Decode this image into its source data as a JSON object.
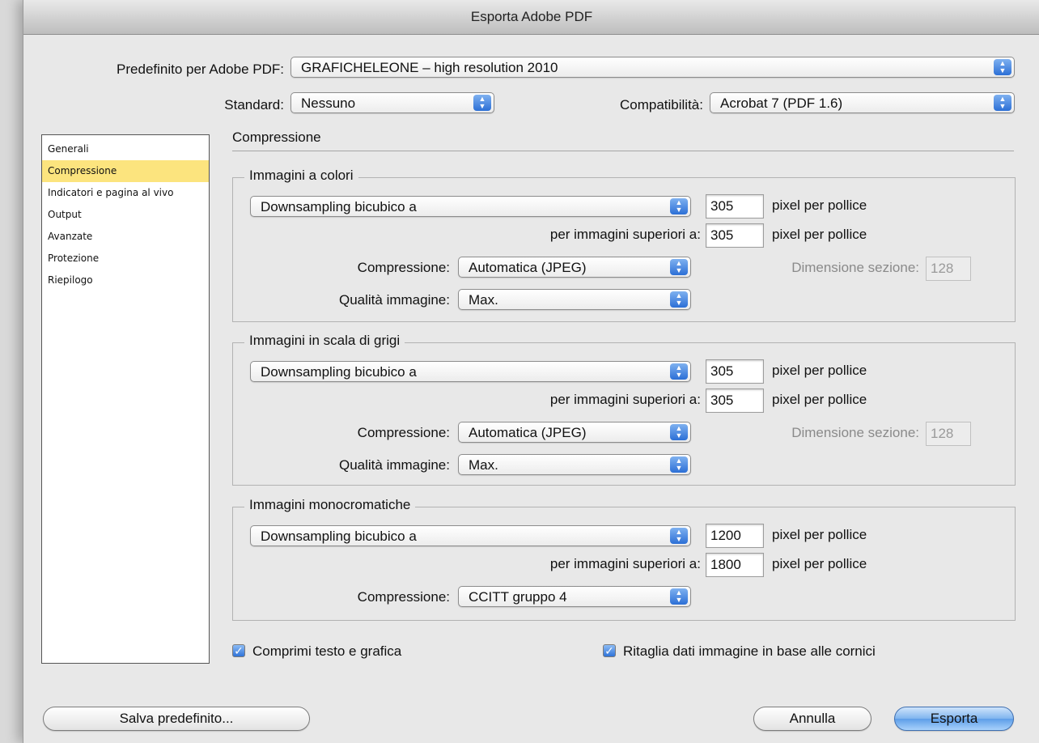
{
  "window": {
    "title": "Esporta Adobe PDF"
  },
  "preset": {
    "label": "Predefinito per Adobe PDF:",
    "value": "GRAFICHELEONE – high resolution 2010"
  },
  "standard": {
    "label": "Standard:",
    "value": "Nessuno"
  },
  "compat": {
    "label": "Compatibilità:",
    "value": "Acrobat 7 (PDF 1.6)"
  },
  "sidebar": {
    "items": [
      {
        "label": "Generali"
      },
      {
        "label": "Compressione"
      },
      {
        "label": "Indicatori e pagina al vivo"
      },
      {
        "label": "Output"
      },
      {
        "label": "Avanzate"
      },
      {
        "label": "Protezione"
      },
      {
        "label": "Riepilogo"
      }
    ],
    "selected": "Compressione"
  },
  "section_title": "Compressione",
  "common": {
    "ppi_unit": "pixel per pollice",
    "above_label": "per immagini superiori a:",
    "compression_label": "Compressione:",
    "quality_label": "Qualità immagine:",
    "tile_label": "Dimensione sezione:"
  },
  "color": {
    "title": "Immagini a colori",
    "method": "Downsampling bicubico a",
    "ppi": "305",
    "above": "305",
    "compression": "Automatica (JPEG)",
    "quality": "Max.",
    "tile": "128"
  },
  "gray": {
    "title": "Immagini in scala di grigi",
    "method": "Downsampling bicubico a",
    "ppi": "305",
    "above": "305",
    "compression": "Automatica (JPEG)",
    "quality": "Max.",
    "tile": "128"
  },
  "mono": {
    "title": "Immagini monocromatiche",
    "method": "Downsampling bicubico a",
    "ppi": "1200",
    "above": "1800",
    "compression": "CCITT gruppo 4"
  },
  "options": {
    "compress_text": {
      "label": "Comprimi testo e grafica",
      "checked": true
    },
    "crop_image": {
      "label": "Ritaglia dati immagine in base alle cornici",
      "checked": true
    }
  },
  "buttons": {
    "save_preset": "Salva predefinito...",
    "cancel": "Annulla",
    "export": "Esporta"
  },
  "colors": {
    "selection": "#fce47e",
    "accent": "#2c6fd6"
  }
}
